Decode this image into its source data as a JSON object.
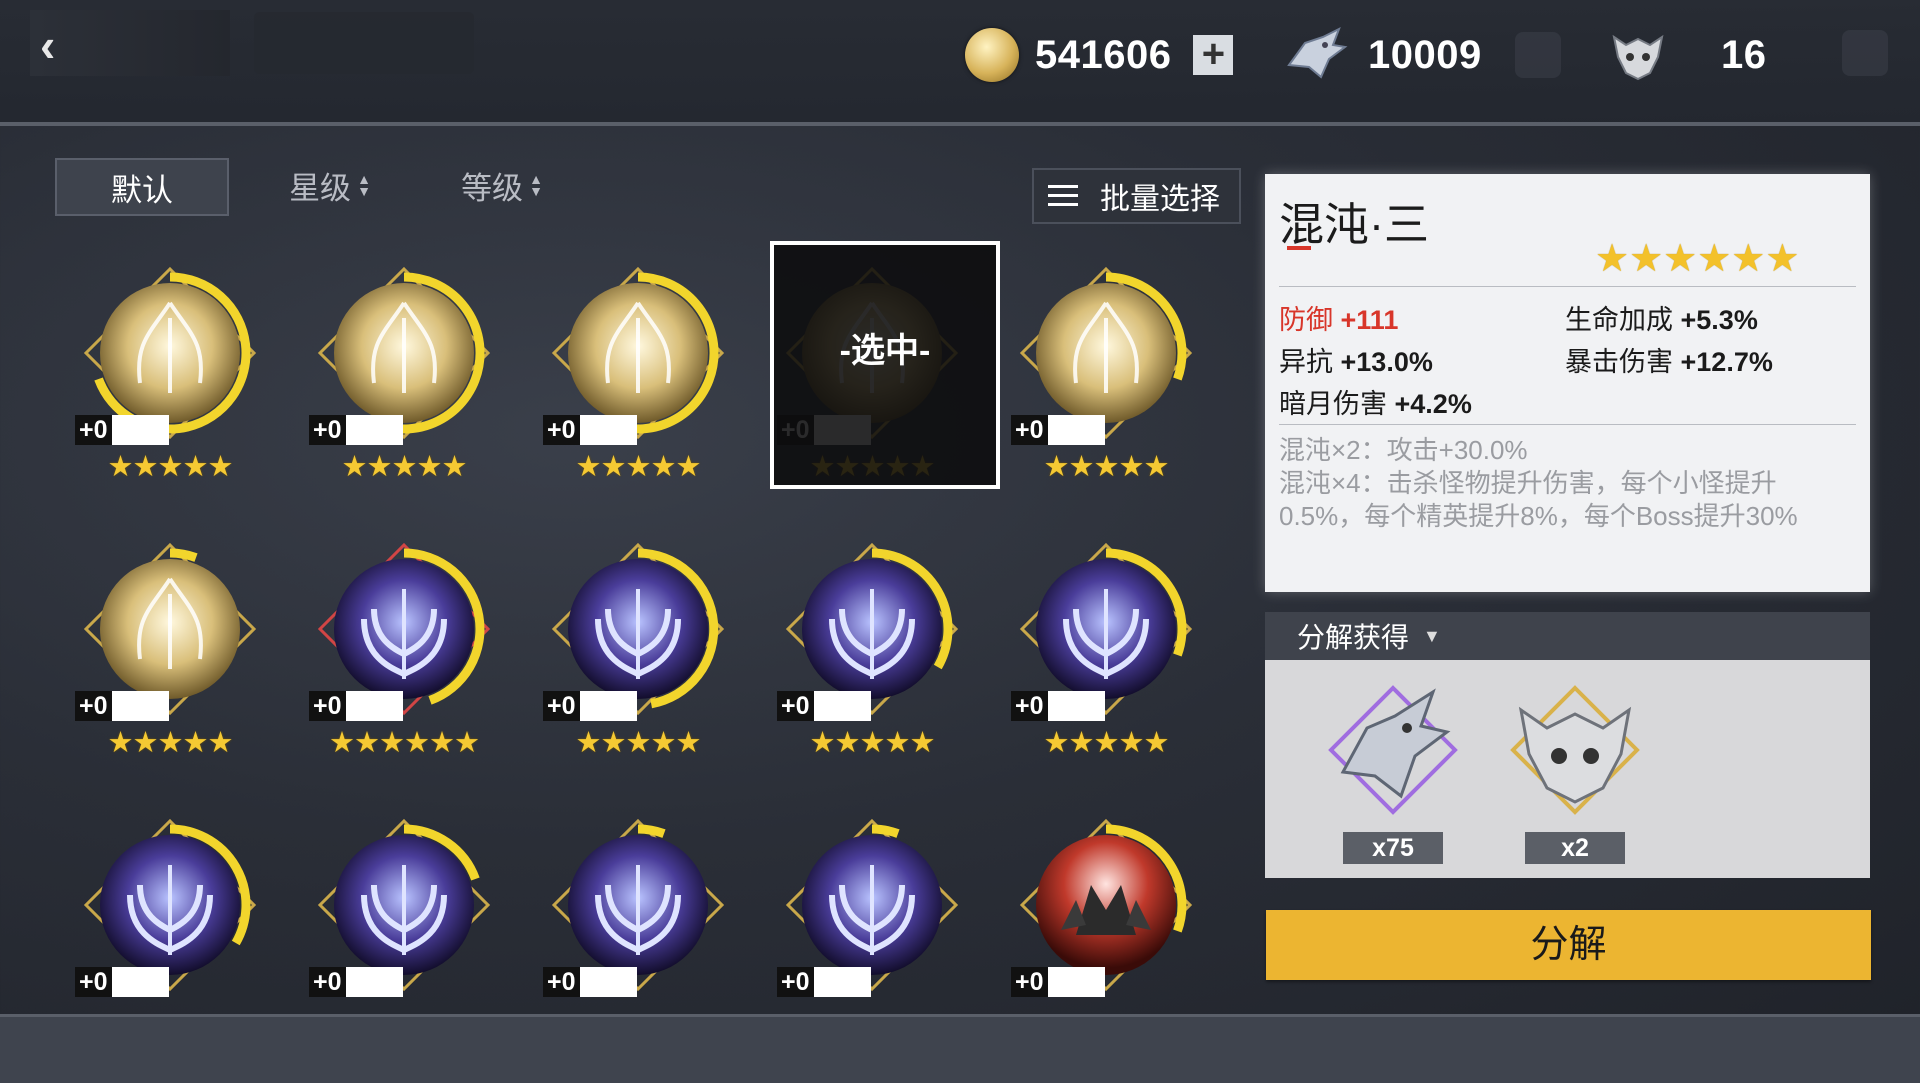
{
  "topbar": {
    "back_icon": "back-arrow-icon",
    "gold": "541606",
    "dragon_shards": "10009",
    "skulls": "16"
  },
  "sort": {
    "default": "默认",
    "star": "星级",
    "level": "等级",
    "batch_select": "批量选择"
  },
  "grid": {
    "selected_label": "-选中-",
    "items": [
      {
        "plus": "+0",
        "stars": "★★★★★",
        "kind": "gold",
        "ring_angle": 250
      },
      {
        "plus": "+0",
        "stars": "★★★★★",
        "kind": "gold",
        "ring_angle": 200
      },
      {
        "plus": "+0",
        "stars": "★★★★★",
        "kind": "gold",
        "ring_angle": 200
      },
      {
        "plus": "+0",
        "stars": "★★★★★",
        "kind": "gold",
        "ring_angle": 0,
        "selected": true
      },
      {
        "plus": "+0",
        "stars": "★★★★★",
        "kind": "gold",
        "ring_angle": 110
      },
      {
        "plus": "+0",
        "stars": "★★★★★",
        "kind": "gold",
        "ring_angle": 20
      },
      {
        "plus": "+0",
        "stars": "★★★★★★",
        "kind": "void",
        "ring_angle": 160
      },
      {
        "plus": "+0",
        "stars": "★★★★★",
        "kind": "void",
        "ring_angle": 170
      },
      {
        "plus": "+0",
        "stars": "★★★★★",
        "kind": "void",
        "ring_angle": 120
      },
      {
        "plus": "+0",
        "stars": "★★★★★",
        "kind": "void",
        "ring_angle": 110
      },
      {
        "plus": "+0",
        "stars": "",
        "kind": "void",
        "ring_angle": 120
      },
      {
        "plus": "+0",
        "stars": "",
        "kind": "void",
        "ring_angle": 70
      },
      {
        "plus": "+0",
        "stars": "",
        "kind": "void",
        "ring_angle": 20
      },
      {
        "plus": "+0",
        "stars": "",
        "kind": "void",
        "ring_angle": 20
      },
      {
        "plus": "+0",
        "stars": "",
        "kind": "wolf",
        "ring_angle": 110
      }
    ]
  },
  "detail": {
    "title": "混沌·三",
    "stars": "★★★★★★",
    "attributes": [
      {
        "label": "防御",
        "value": "+111",
        "highlight": true
      },
      {
        "label": "生命加成",
        "value": "+5.3%"
      },
      {
        "label": "异抗",
        "value": "+13.0%"
      },
      {
        "label": "暴击伤害",
        "value": "+12.7%"
      },
      {
        "label": "暗月伤害",
        "value": "+4.2%"
      }
    ],
    "set_bonus_2": "混沌×2：攻击+30.0%",
    "set_bonus_4": "混沌×4：击杀怪物提升伤害，每个小怪提升0.5%，每个精英提升8%，每个Boss提升30%"
  },
  "decompose": {
    "header": "分解获得",
    "rewards": [
      {
        "name": "dragon-shard",
        "qty": "x75"
      },
      {
        "name": "skull-token",
        "qty": "x2"
      }
    ],
    "button": "分解"
  },
  "colors": {
    "accent": "#ecb531",
    "star": "#f5c933",
    "highlight_red": "#d8362a"
  }
}
